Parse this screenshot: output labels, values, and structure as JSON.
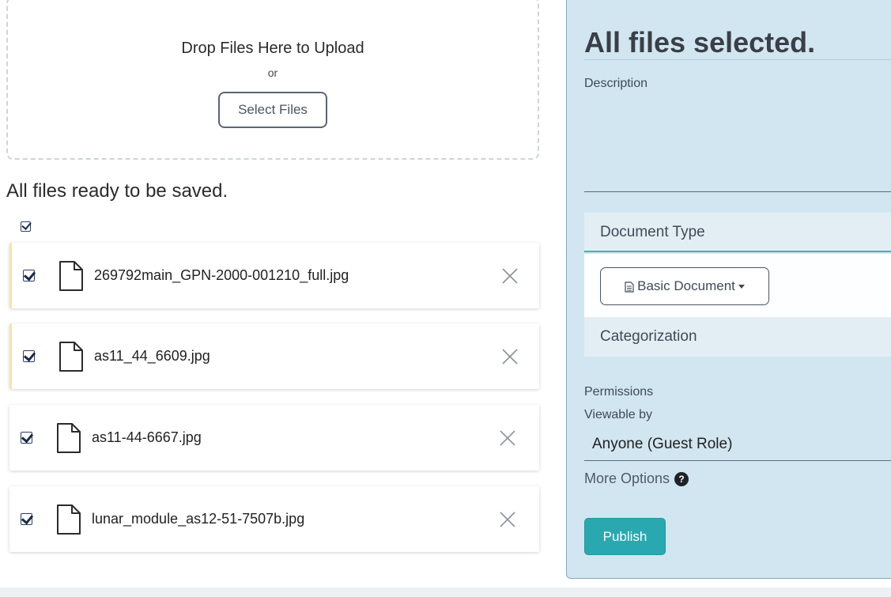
{
  "upload": {
    "drop_title": "Drop Files Here to Upload",
    "or_text": "or",
    "select_button": "Select Files"
  },
  "files_section": {
    "heading": "All files ready to be saved.",
    "select_all_checked": true,
    "files": [
      {
        "name": "269792main_GPN-2000-001210_full.jpg",
        "checked": true,
        "icon": "file-icon",
        "remove_icon": "close-icon"
      },
      {
        "name": "as11_44_6609.jpg",
        "checked": true,
        "icon": "file-icon",
        "remove_icon": "close-icon"
      },
      {
        "name": "as11-44-6667.jpg",
        "checked": true,
        "icon": "file-icon",
        "remove_icon": "close-icon"
      },
      {
        "name": "lunar_module_as12-51-7507b.jpg",
        "checked": true,
        "icon": "file-icon",
        "remove_icon": "close-icon"
      }
    ]
  },
  "panel": {
    "title": "All files selected.",
    "description_label": "Description",
    "description_value": "",
    "document_type_heading": "Document Type",
    "document_type_button": "Basic Document",
    "categorization_heading": "Categorization",
    "permissions_label": "Permissions",
    "viewable_label": "Viewable by",
    "viewable_value": "Anyone (Guest Role)",
    "more_options": "More Options",
    "help_icon_glyph": "?",
    "publish_button": "Publish"
  },
  "colors": {
    "panel_bg": "#d1e6f0",
    "accent_teal": "#2aa8b0",
    "pending_marker": "#f5e6a6"
  }
}
